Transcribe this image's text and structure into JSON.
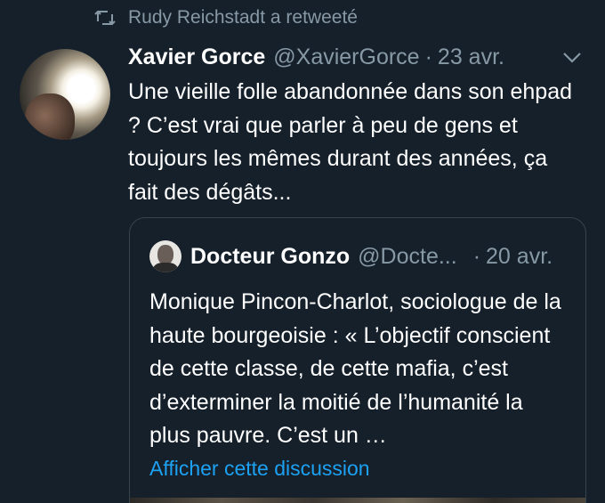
{
  "retweet": {
    "text": "Rudy Reichstadt a retweeté",
    "icon": "retweet-icon"
  },
  "tweet": {
    "display_name": "Xavier Gorce",
    "handle": "@XavierGorce",
    "separator": "·",
    "date": "23 avr.",
    "text": "Une vieille folle abandonnée dans son ehpad ? C’est vrai que parler à peu de gens et toujours les mêmes durant des années, ça fait des dégâts..."
  },
  "quote": {
    "display_name": "Docteur Gonzo",
    "handle": "@Docte...",
    "separator": "·",
    "date": "20 avr.",
    "text": "Monique Pincon-Charlot, sociologue de la haute bourgeoisie : « L’objectif conscient de cette classe, de cette mafia, c’est d’exterminer la moitié de l’humanité la plus pauvre. C’est un …",
    "link": "Afficher cette discussion"
  },
  "colors": {
    "background": "#15202b",
    "secondary_text": "#8899a6",
    "link": "#1da1f2",
    "border": "#38444d"
  }
}
